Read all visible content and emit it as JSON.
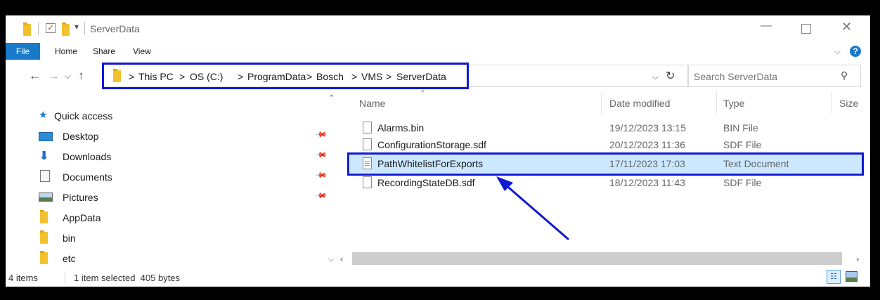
{
  "window": {
    "title": "ServerData"
  },
  "ribbon": {
    "file": "File",
    "home": "Home",
    "share": "Share",
    "view": "View"
  },
  "address": {
    "separator": ">",
    "crumbs": [
      "This PC",
      "OS (C:)",
      "ProgramData",
      "Bosch",
      "VMS",
      "ServerData"
    ],
    "search_placeholder": "Search ServerData"
  },
  "nav": {
    "quick_access": "Quick access",
    "items": [
      {
        "label": "Desktop",
        "icon": "desktop-icon",
        "pinned": true
      },
      {
        "label": "Downloads",
        "icon": "download-arrow-icon",
        "pinned": true
      },
      {
        "label": "Documents",
        "icon": "document-icon",
        "pinned": true
      },
      {
        "label": "Pictures",
        "icon": "pictures-icon",
        "pinned": true
      },
      {
        "label": "AppData",
        "icon": "folder-icon",
        "pinned": false
      },
      {
        "label": "bin",
        "icon": "folder-icon",
        "pinned": false
      },
      {
        "label": "etc",
        "icon": "folder-icon",
        "pinned": false
      }
    ]
  },
  "columns": {
    "name": "Name",
    "date": "Date modified",
    "type": "Type",
    "size": "Size"
  },
  "files": [
    {
      "name": "Alarms.bin",
      "date": "19/12/2023 13:15",
      "type": "BIN File",
      "selected": false
    },
    {
      "name": "ConfigurationStorage.sdf",
      "date": "20/12/2023 11:36",
      "type": "SDF File",
      "selected": false
    },
    {
      "name": "PathWhitelistForExports",
      "date": "17/11/2023 17:03",
      "type": "Text Document",
      "selected": true
    },
    {
      "name": "RecordingStateDB.sdf",
      "date": "18/12/2023 11:43",
      "type": "SDF File",
      "selected": false
    }
  ],
  "status": {
    "items": "4 items",
    "selection": "1 item selected  405 bytes"
  },
  "colors": {
    "accent": "#1979ca",
    "annotation": "#1018d6",
    "selected_row": "#cce8ff",
    "folder": "#f2c12e"
  }
}
